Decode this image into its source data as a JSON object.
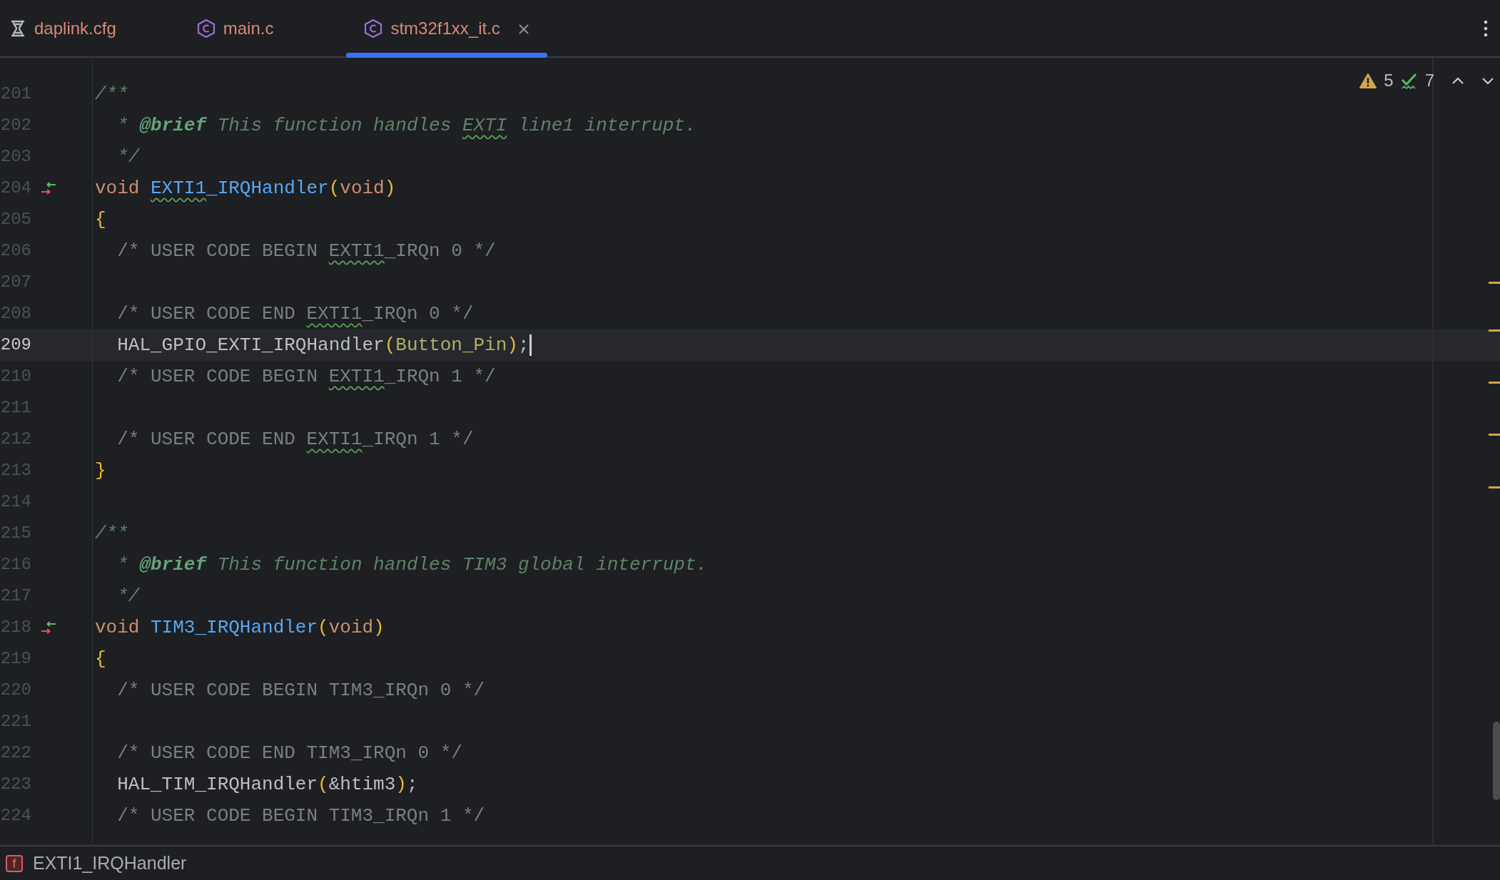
{
  "tabs": [
    {
      "label": "daplink.cfg",
      "kind": "config",
      "selected": false,
      "closable": false
    },
    {
      "label": "main.c",
      "kind": "c",
      "selected": false,
      "closable": false
    },
    {
      "label": "stm32f1xx_it.c",
      "kind": "c",
      "selected": true,
      "closable": true
    }
  ],
  "inspections": {
    "warnings": "5",
    "weak_warnings": "7"
  },
  "lines": [
    {
      "number": "201",
      "current": false,
      "tokens": [
        {
          "t": "/**",
          "kind": "doc"
        }
      ]
    },
    {
      "number": "202",
      "current": false,
      "tokens": [
        {
          "t": "  * ",
          "kind": "doc"
        },
        {
          "t": "@brief",
          "kind": "doctag"
        },
        {
          "t": " This function handles ",
          "kind": "doc"
        },
        {
          "t": "EXTI",
          "kind": "doc_flagged"
        },
        {
          "t": " line1 interrupt.",
          "kind": "doc"
        }
      ]
    },
    {
      "number": "203",
      "current": false,
      "tokens": [
        {
          "t": "  */",
          "kind": "doc"
        }
      ]
    },
    {
      "number": "204",
      "current": false,
      "kind": "declaration",
      "tokens": [
        {
          "t": "void ",
          "kind": "keyword"
        },
        {
          "t": "EXTI1",
          "kind": "function_flagged"
        },
        {
          "t": "_IRQHandler",
          "kind": "function"
        },
        {
          "t": "(",
          "kind": "bracket"
        },
        {
          "t": "void",
          "kind": "keyword"
        },
        {
          "t": ")",
          "kind": "bracket"
        }
      ]
    },
    {
      "number": "205",
      "current": false,
      "tokens": [
        {
          "t": "{",
          "kind": "bracket"
        }
      ]
    },
    {
      "number": "206",
      "current": false,
      "tokens": [
        {
          "t": "  /* USER CODE BEGIN ",
          "kind": "comment"
        },
        {
          "t": "EXTI1",
          "kind": "comment_flagged"
        },
        {
          "t": "_IRQn 0 */",
          "kind": "comment"
        }
      ]
    },
    {
      "number": "207",
      "current": false
    },
    {
      "number": "208",
      "current": false,
      "tokens": [
        {
          "t": "  /* USER CODE END ",
          "kind": "comment"
        },
        {
          "t": "EXTI1",
          "kind": "comment_flagged"
        },
        {
          "t": "_IRQn 0 */",
          "kind": "comment"
        }
      ]
    },
    {
      "number": "209",
      "current": true,
      "tokens": [
        {
          "t": "  HAL_GPIO_EXTI_IRQHandler",
          "kind": "plain"
        },
        {
          "t": "(",
          "kind": "bracket"
        },
        {
          "t": "Button_Pin",
          "kind": "macro"
        },
        {
          "t": ")",
          "kind": "bracket"
        },
        {
          "t": ";",
          "kind": "plain"
        }
      ]
    },
    {
      "number": "210",
      "current": false,
      "tokens": [
        {
          "t": "  /* USER CODE BEGIN ",
          "kind": "comment"
        },
        {
          "t": "EXTI1",
          "kind": "comment_flagged"
        },
        {
          "t": "_IRQn 1 */",
          "kind": "comment"
        }
      ]
    },
    {
      "number": "211",
      "current": false
    },
    {
      "number": "212",
      "current": false,
      "tokens": [
        {
          "t": "  /* USER CODE END ",
          "kind": "comment"
        },
        {
          "t": "EXTI1",
          "kind": "comment_flagged"
        },
        {
          "t": "_IRQn 1 */",
          "kind": "comment"
        }
      ]
    },
    {
      "number": "213",
      "current": false,
      "tokens": [
        {
          "t": "}",
          "kind": "bracket"
        }
      ]
    },
    {
      "number": "214",
      "current": false
    },
    {
      "number": "215",
      "current": false,
      "tokens": [
        {
          "t": "/**",
          "kind": "doc"
        }
      ]
    },
    {
      "number": "216",
      "current": false,
      "tokens": [
        {
          "t": "  * ",
          "kind": "doc"
        },
        {
          "t": "@brief",
          "kind": "doctag"
        },
        {
          "t": " This function handles TIM3 global interrupt.",
          "kind": "doc"
        }
      ]
    },
    {
      "number": "217",
      "current": false,
      "tokens": [
        {
          "t": "  */",
          "kind": "doc"
        }
      ]
    },
    {
      "number": "218",
      "current": false,
      "kind": "declaration",
      "tokens": [
        {
          "t": "void ",
          "kind": "keyword"
        },
        {
          "t": "TIM3_IRQHandler",
          "kind": "function"
        },
        {
          "t": "(",
          "kind": "bracket"
        },
        {
          "t": "void",
          "kind": "keyword"
        },
        {
          "t": ")",
          "kind": "bracket"
        }
      ]
    },
    {
      "number": "219",
      "current": false,
      "tokens": [
        {
          "t": "{",
          "kind": "bracket"
        }
      ]
    },
    {
      "number": "220",
      "current": false,
      "tokens": [
        {
          "t": "  /* USER CODE BEGIN TIM3_IRQn 0 */",
          "kind": "comment"
        }
      ]
    },
    {
      "number": "221",
      "current": false
    },
    {
      "number": "222",
      "current": false,
      "tokens": [
        {
          "t": "  /* USER CODE END TIM3_IRQn 0 */",
          "kind": "comment"
        }
      ]
    },
    {
      "number": "223",
      "current": false,
      "tokens": [
        {
          "t": "  HAL_TIM_IRQHandler",
          "kind": "plain"
        },
        {
          "t": "(",
          "kind": "bracket"
        },
        {
          "t": "&htim3",
          "kind": "plain"
        },
        {
          "t": ")",
          "kind": "bracket"
        },
        {
          "t": ";",
          "kind": "plain"
        }
      ]
    },
    {
      "number": "224",
      "current": false,
      "tokens": [
        {
          "t": "  /* USER CODE BEGIN TIM3_IRQn 1 */",
          "kind": "comment"
        }
      ]
    }
  ],
  "breadcrumb": {
    "icon_letter": "f",
    "label": "EXTI1_IRQHandler"
  }
}
